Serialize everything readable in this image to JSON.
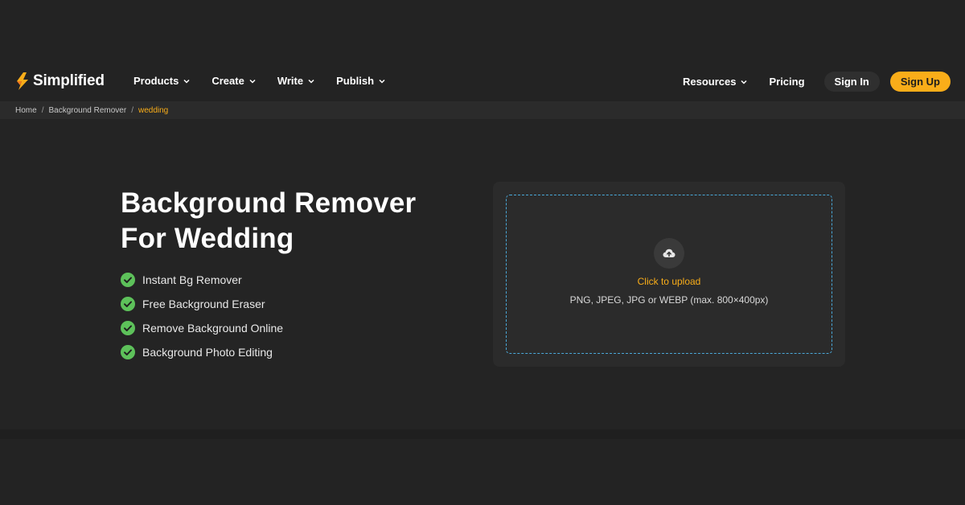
{
  "brand": {
    "name": "Simplified",
    "accent": "#f9ad19"
  },
  "nav": {
    "left": [
      {
        "label": "Products"
      },
      {
        "label": "Create"
      },
      {
        "label": "Write"
      },
      {
        "label": "Publish"
      }
    ],
    "resources_label": "Resources",
    "pricing_label": "Pricing",
    "signin_label": "Sign In",
    "signup_label": "Sign Up"
  },
  "breadcrumb": [
    "Home",
    "Background Remover",
    "wedding"
  ],
  "hero": {
    "title_line1": "Background Remover",
    "title_line2": "For Wedding",
    "features": [
      "Instant Bg Remover",
      "Free Background Eraser",
      "Remove Background Online",
      "Background Photo Editing"
    ]
  },
  "upload": {
    "icon": "cloud-upload-icon",
    "cta": "Click to upload",
    "hint": "PNG, JPEG, JPG or WEBP (max. 800×400px)"
  }
}
